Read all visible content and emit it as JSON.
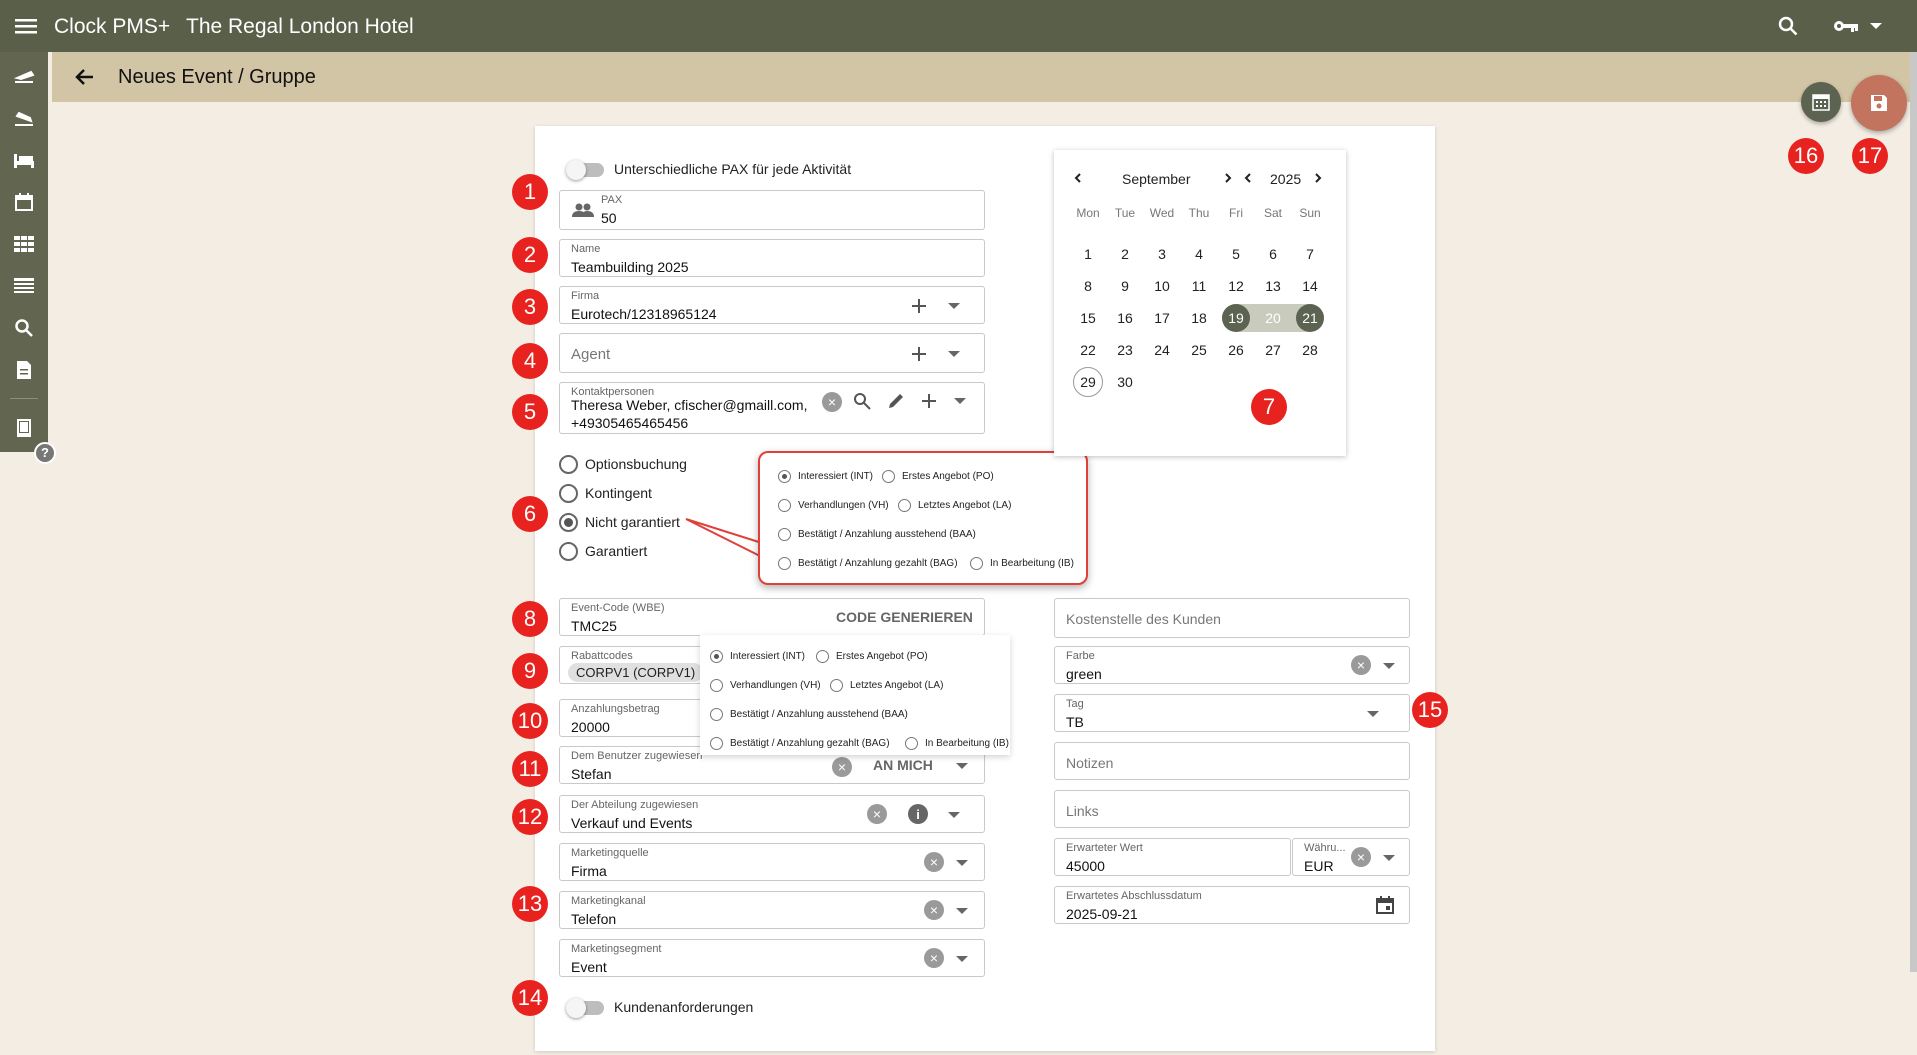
{
  "app": {
    "name": "Clock PMS+",
    "hotel": "The Regal London Hotel"
  },
  "page": {
    "title": "Neues Event / Gruppe"
  },
  "toggles": {
    "pax_label": "Unterschiedliche PAX für jede Aktivität",
    "requirements_label": "Kundenanforderungen"
  },
  "fields": {
    "pax": {
      "label": "PAX",
      "value": "50"
    },
    "name": {
      "label": "Name",
      "value": "Teambuilding 2025"
    },
    "firma": {
      "label": "Firma",
      "value": "Eurotech/12318965124"
    },
    "agent": {
      "placeholder": "Agent"
    },
    "kontakt": {
      "label": "Kontaktpersonen",
      "line1": "Theresa Weber, cfischer@gmaill.com,",
      "line2": "+49305465465456"
    },
    "event_code": {
      "label": "Event-Code (WBE)",
      "value": "TMC25",
      "button": "CODE GENERIEREN"
    },
    "rabatt": {
      "label": "Rabattcodes",
      "chip": "CORPV1 (CORPV1)"
    },
    "anzahlung": {
      "label": "Anzahlungsbetrag",
      "value": "20000"
    },
    "benutzer": {
      "label": "Dem Benutzer zugewiesen",
      "value": "Stefan",
      "button": "AN MICH"
    },
    "abteilung": {
      "label": "Der Abteilung zugewiesen",
      "value": "Verkauf und Events"
    },
    "mquelle": {
      "label": "Marketingquelle",
      "value": "Firma"
    },
    "mkanal": {
      "label": "Marketingkanal",
      "value": "Telefon"
    },
    "msegment": {
      "label": "Marketingsegment",
      "value": "Event"
    },
    "kostenstelle": {
      "placeholder": "Kostenstelle des Kunden"
    },
    "farbe": {
      "label": "Farbe",
      "value": "green"
    },
    "tag": {
      "label": "Tag",
      "value": "TB"
    },
    "notizen": {
      "placeholder": "Notizen"
    },
    "links": {
      "placeholder": "Links"
    },
    "wert": {
      "label": "Erwarteter Wert",
      "value": "45000"
    },
    "waehrung": {
      "label": "Währu...",
      "value": "EUR"
    },
    "abschluss": {
      "label": "Erwartetes Abschlussdatum",
      "value": "2025-09-21"
    }
  },
  "booking_types": [
    "Optionsbuchung",
    "Kontingent",
    "Nicht garantiert",
    "Garantiert"
  ],
  "status_options": [
    "Interessiert (INT)",
    "Erstes Angebot (PO)",
    "Verhandlungen (VH)",
    "Letztes Angebot (LA)",
    "Bestätigt / Anzahlung ausstehend (BAA)",
    "Bestätigt / Anzahlung gezahlt (BAG)",
    "In Bearbeitung (IB)"
  ],
  "calendar": {
    "month": "September",
    "year": "2025",
    "weekdays": [
      "Mon",
      "Tue",
      "Wed",
      "Thu",
      "Fri",
      "Sat",
      "Sun"
    ],
    "days": [
      "1",
      "2",
      "3",
      "4",
      "5",
      "6",
      "7",
      "8",
      "9",
      "10",
      "11",
      "12",
      "13",
      "14",
      "15",
      "16",
      "17",
      "18",
      "19",
      "20",
      "21",
      "22",
      "23",
      "24",
      "25",
      "26",
      "27",
      "28",
      "29",
      "30"
    ]
  },
  "badges": [
    "1",
    "2",
    "3",
    "4",
    "5",
    "6",
    "7",
    "8",
    "9",
    "10",
    "11",
    "12",
    "13",
    "14",
    "15",
    "16",
    "17"
  ],
  "colors": {
    "topbar": "#5a5f49",
    "subbar": "#d2c5a5",
    "badge": "#e8231f",
    "selected": "#5c6350",
    "save": "#c2745f"
  }
}
